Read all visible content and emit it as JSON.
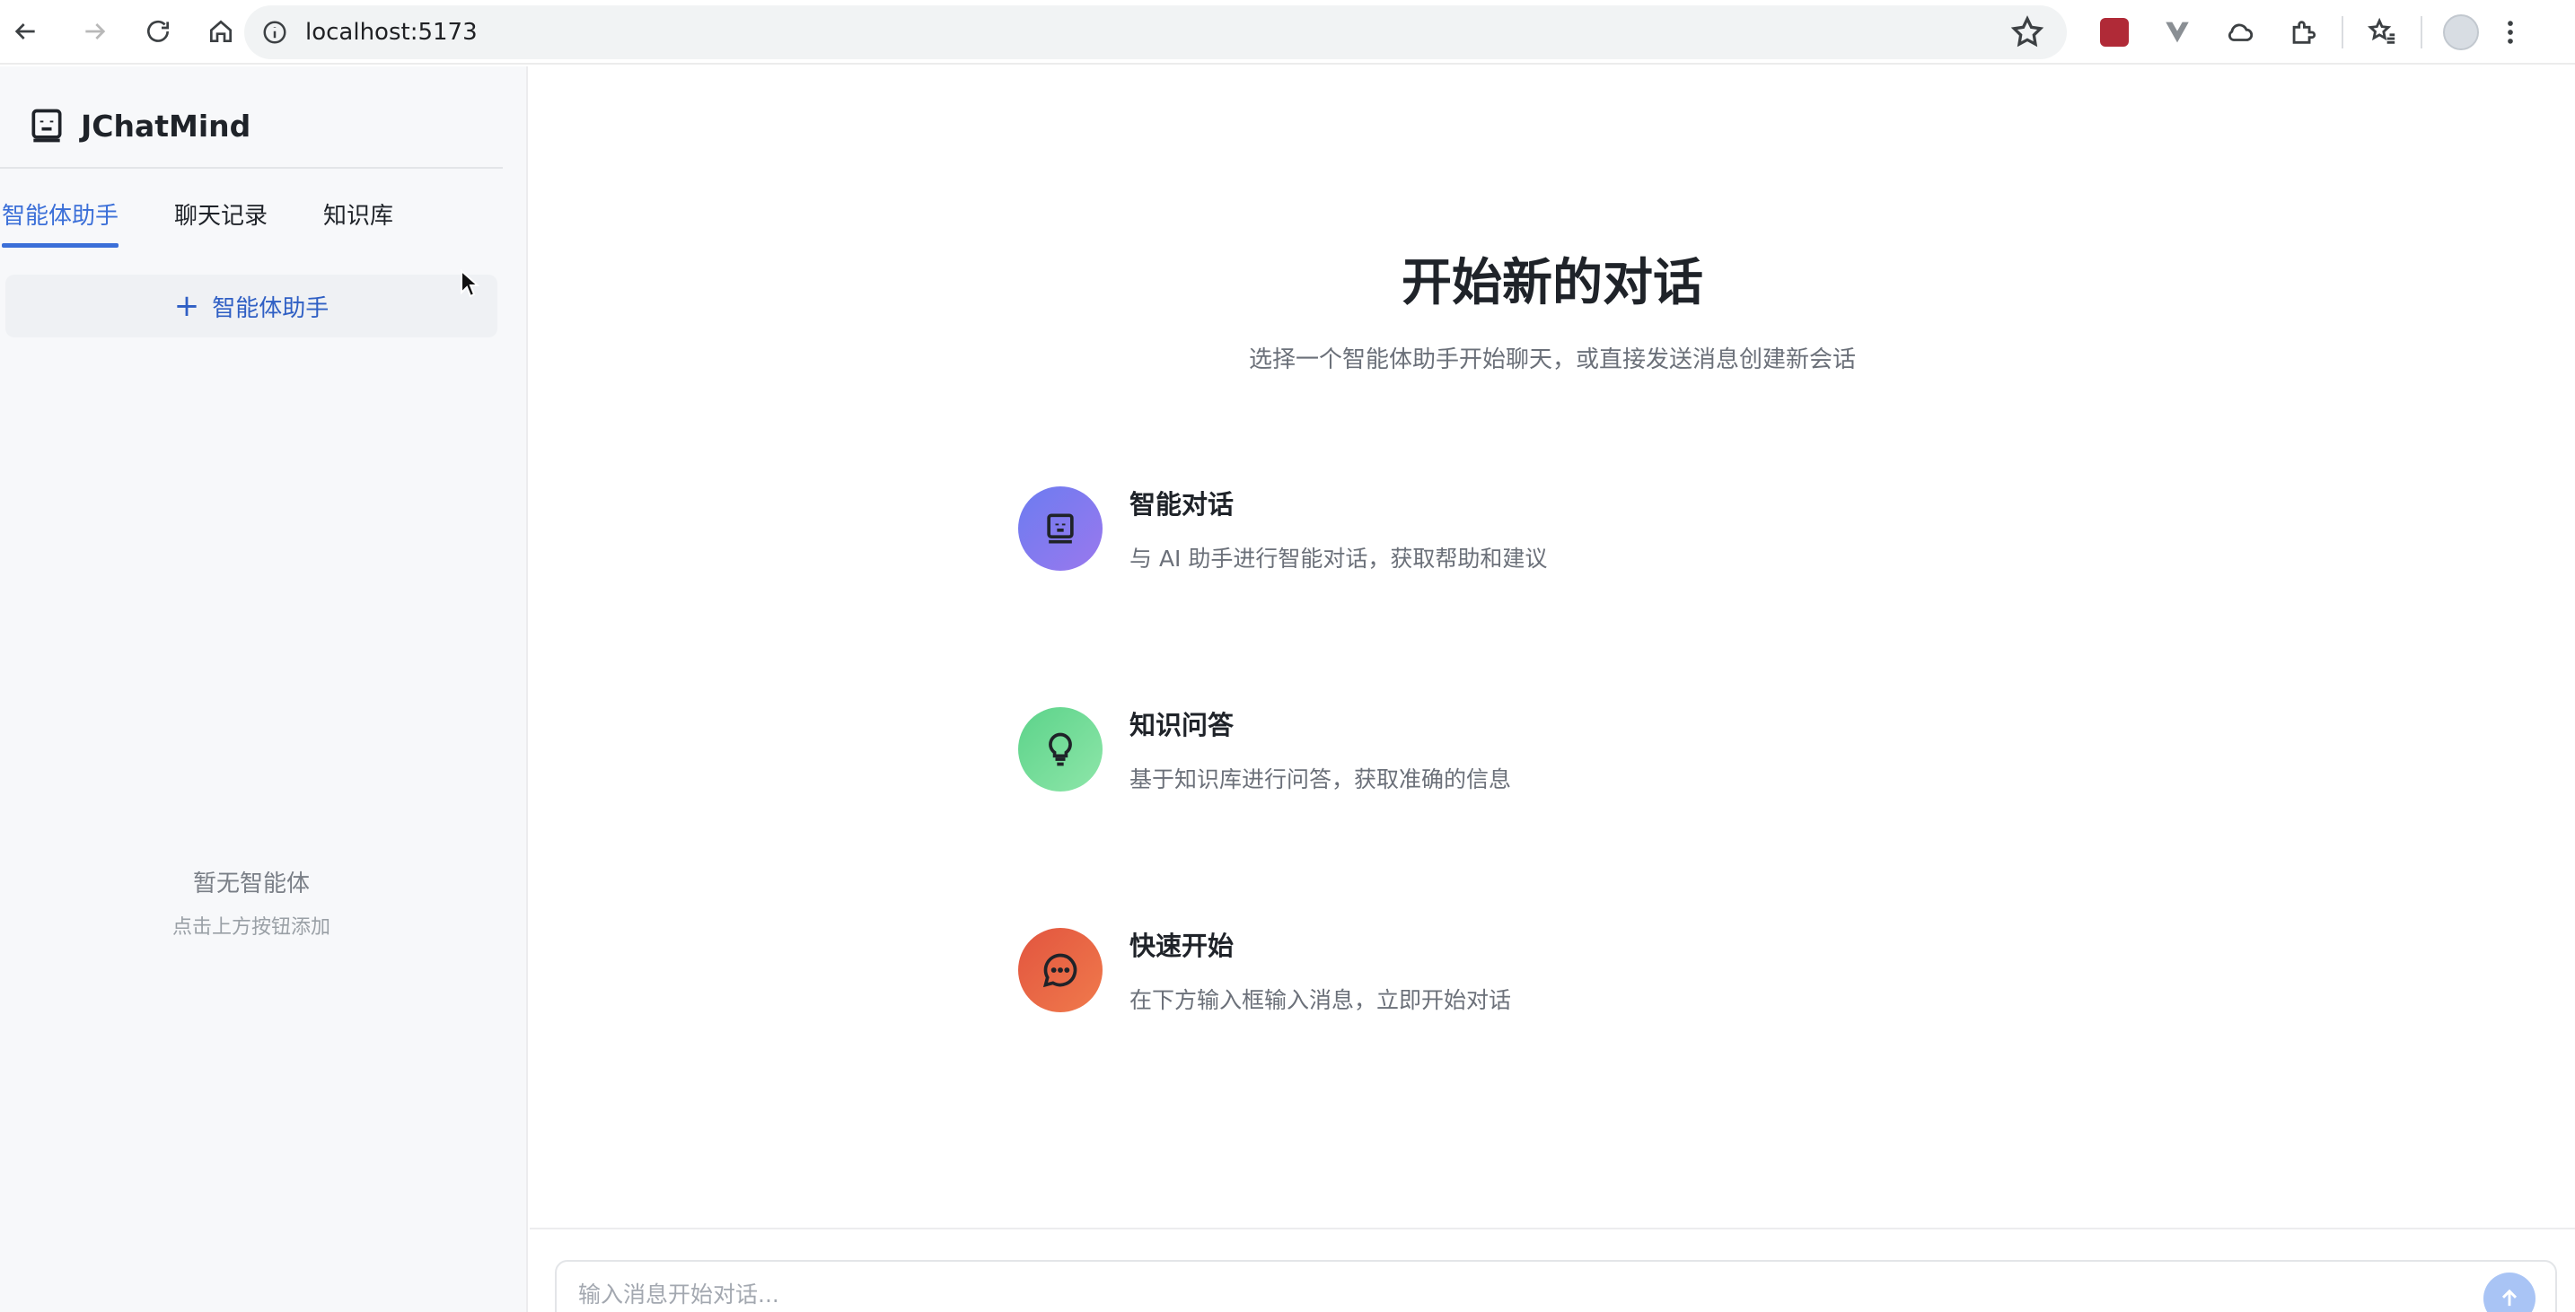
{
  "browser": {
    "url": "localhost:5173"
  },
  "sidebar": {
    "app_name": "JChatMind",
    "tabs": [
      {
        "label": "智能体助手",
        "active": true
      },
      {
        "label": "聊天记录",
        "active": false
      },
      {
        "label": "知识库",
        "active": false
      }
    ],
    "add_button_label": "智能体助手",
    "empty_title": "暂无智能体",
    "empty_hint": "点击上方按钮添加"
  },
  "main": {
    "title": "开始新的对话",
    "subtitle": "选择一个智能体助手开始聊天，或直接发送消息创建新会话",
    "cards": [
      {
        "title": "智能对话",
        "desc": "与 AI 助手进行智能对话，获取帮助和建议",
        "icon": "robot-icon",
        "color": "#7b7af0"
      },
      {
        "title": "知识问答",
        "desc": "基于知识库进行问答，获取准确的信息",
        "icon": "bulb-icon",
        "color": "#6fdc97"
      },
      {
        "title": "快速开始",
        "desc": "在下方输入框输入消息，立即开始对话",
        "icon": "chat-bubble-icon",
        "color": "#e8643f"
      }
    ],
    "input_placeholder": "输入消息开始对话..."
  },
  "colors": {
    "accent": "#3b6fd8",
    "sidebar_bg": "#f7f8fa"
  }
}
